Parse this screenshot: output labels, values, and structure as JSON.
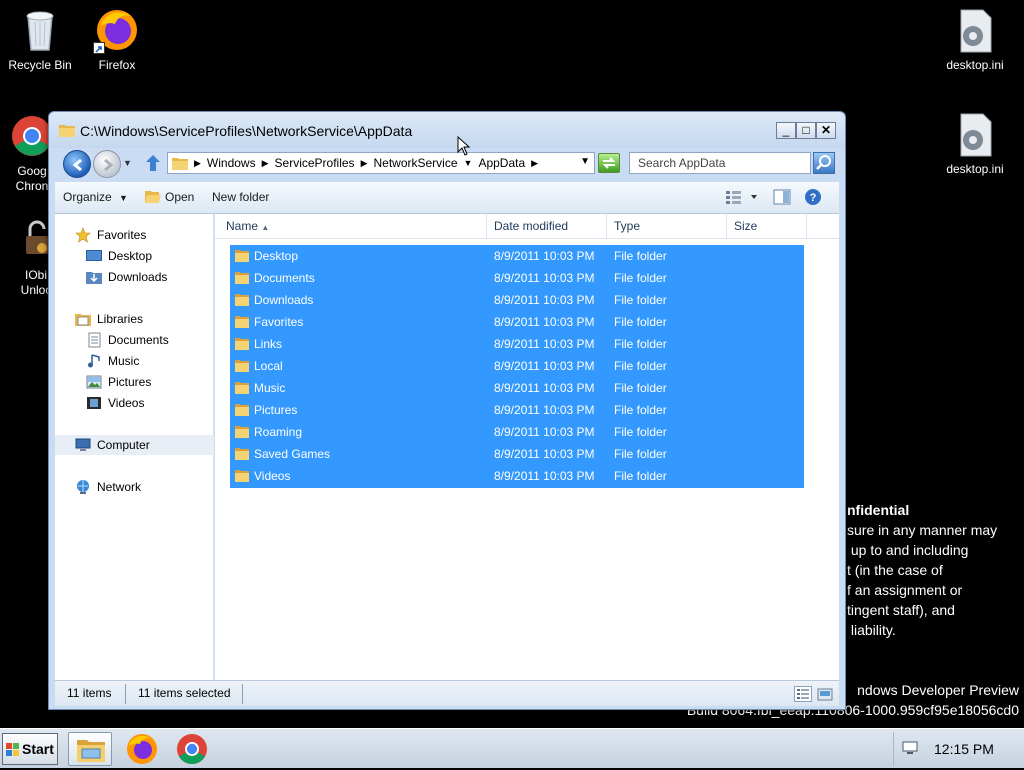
{
  "desktop": {
    "icons": [
      {
        "label": "Recycle Bin",
        "icon": "recycle-bin-icon"
      },
      {
        "label": "Firefox",
        "icon": "firefox-icon"
      },
      {
        "label": "Goog\nChron",
        "icon": "chrome-icon"
      },
      {
        "label": "IObi\nUnloc",
        "icon": "iobit-unlocker-icon"
      },
      {
        "label": "desktop.ini",
        "icon": "settings-file-icon"
      },
      {
        "label": "desktop.ini",
        "icon": "settings-file-icon"
      }
    ],
    "watermark": {
      "heading": "nfidential",
      "lines": [
        "sure in any manner may",
        " up to and including",
        "t (in the case of",
        "f an assignment or",
        "tingent staff), and",
        " liability."
      ]
    },
    "build": {
      "line1": "ndows Developer Preview",
      "line2": "Build 8064.fbl_eeap.110806-1000.959cf95e18056cd0"
    }
  },
  "window": {
    "title": "C:\\Windows\\ServiceProfiles\\NetworkService\\AppData",
    "controls": {
      "minimize": "_",
      "maximize": "□",
      "close": "✕"
    },
    "breadcrumbs": [
      "Windows",
      "ServiceProfiles",
      "NetworkService",
      "AppData"
    ],
    "search_placeholder": "Search AppData",
    "commands": {
      "organize": "Organize",
      "open": "Open",
      "new_folder": "New folder"
    },
    "nav": {
      "favorites": {
        "label": "Favorites",
        "items": [
          "Desktop",
          "Downloads"
        ]
      },
      "libraries": {
        "label": "Libraries",
        "items": [
          "Documents",
          "Music",
          "Pictures",
          "Videos"
        ]
      },
      "computer": "Computer",
      "network": "Network"
    },
    "columns": {
      "name": "Name",
      "date_modified": "Date modified",
      "type": "Type",
      "size": "Size"
    },
    "files": [
      {
        "name": "Desktop",
        "date": "8/9/2011 10:03 PM",
        "type": "File folder"
      },
      {
        "name": "Documents",
        "date": "8/9/2011 10:03 PM",
        "type": "File folder"
      },
      {
        "name": "Downloads",
        "date": "8/9/2011 10:03 PM",
        "type": "File folder"
      },
      {
        "name": "Favorites",
        "date": "8/9/2011 10:03 PM",
        "type": "File folder"
      },
      {
        "name": "Links",
        "date": "8/9/2011 10:03 PM",
        "type": "File folder"
      },
      {
        "name": "Local",
        "date": "8/9/2011 10:03 PM",
        "type": "File folder"
      },
      {
        "name": "Music",
        "date": "8/9/2011 10:03 PM",
        "type": "File folder"
      },
      {
        "name": "Pictures",
        "date": "8/9/2011 10:03 PM",
        "type": "File folder"
      },
      {
        "name": "Roaming",
        "date": "8/9/2011 10:03 PM",
        "type": "File folder"
      },
      {
        "name": "Saved Games",
        "date": "8/9/2011 10:03 PM",
        "type": "File folder"
      },
      {
        "name": "Videos",
        "date": "8/9/2011 10:03 PM",
        "type": "File folder"
      }
    ],
    "status": {
      "count": "11 items",
      "selected": "11 items selected"
    }
  },
  "taskbar": {
    "start_label": "Start",
    "apps": [
      "explorer-icon",
      "firefox-icon",
      "chrome-icon"
    ],
    "clock": "12:15 PM"
  },
  "colors": {
    "selection": "#3399ff",
    "titlebar": "#c9dcf3",
    "desktop": "#000000"
  }
}
